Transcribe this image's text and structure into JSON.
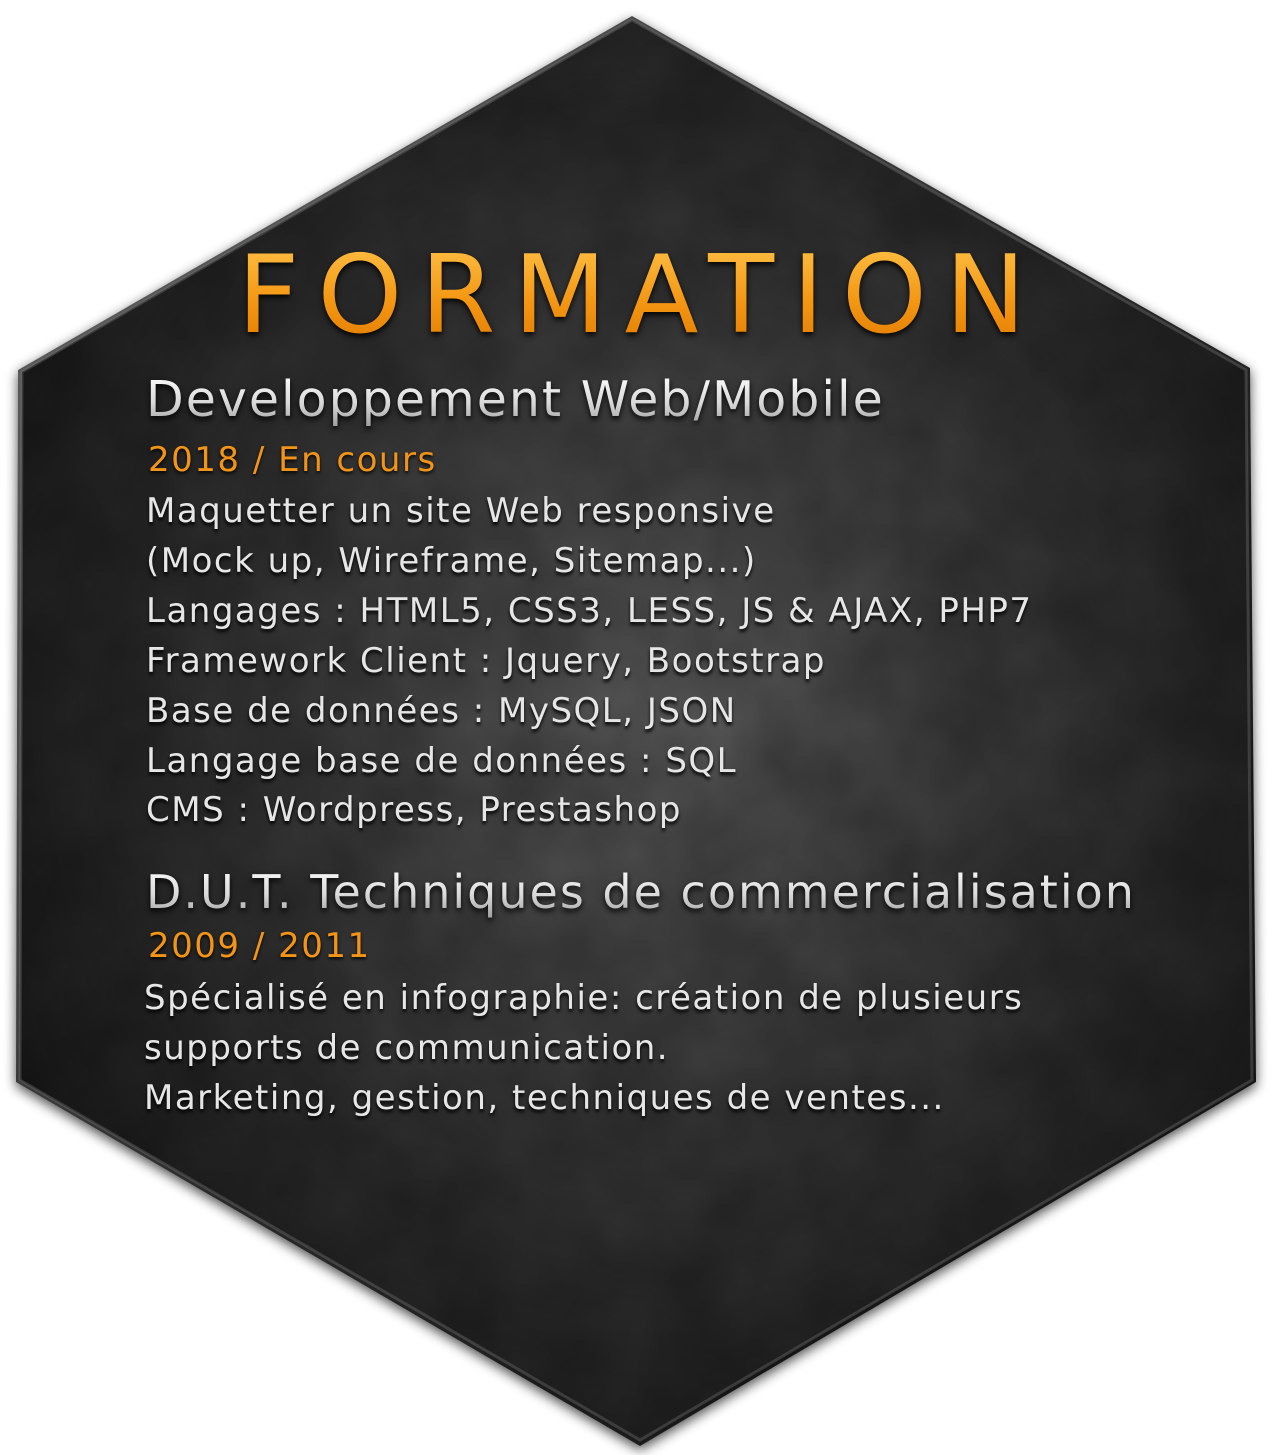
{
  "title": "FORMATION",
  "colors": {
    "accent": "#f29418",
    "panel": "#2e2e2e",
    "text": "#e6e6e6"
  },
  "sections": [
    {
      "heading": "Developpement Web/Mobile",
      "date": "2018 / En cours",
      "lines": [
        "Maquetter un site Web responsive",
        "(Mock up, Wireframe, Sitemap...)",
        "Langages : HTML5, CSS3, LESS, JS & AJAX, PHP7",
        "Framework Client : Jquery, Bootstrap",
        "Base de données : MySQL, JSON",
        "Langage base de données : SQL",
        "CMS : Wordpress, Prestashop"
      ]
    },
    {
      "heading": "D.U.T. Techniques de commercialisation",
      "date": "2009 / 2011",
      "lines": [
        "Spécialisé en infographie: création de plusieurs",
        "supports de communication.",
        "Marketing, gestion, techniques de ventes..."
      ]
    }
  ]
}
